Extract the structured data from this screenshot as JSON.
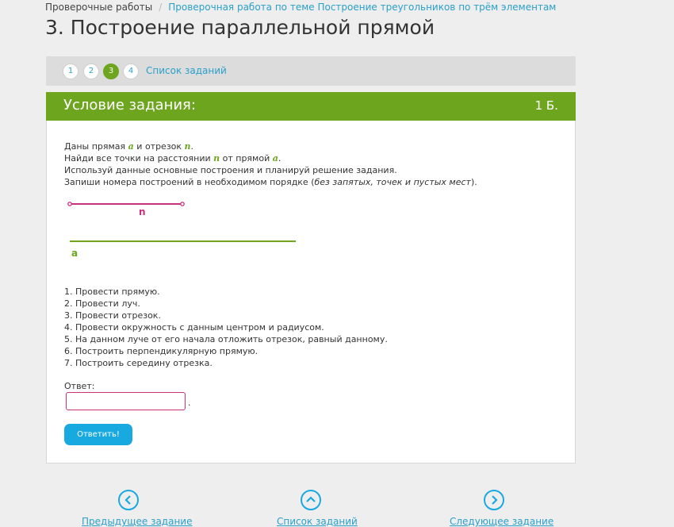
{
  "breadcrumb": {
    "root": "Проверочные работы",
    "current": "Проверочная работа по теме Построение треугольников по трём элементам"
  },
  "page_title": "3. Построение параллельной прямой",
  "steps_nav": {
    "items": [
      "1",
      "2",
      "3",
      "4"
    ],
    "active": "3",
    "task_list_link": "Список заданий"
  },
  "card": {
    "title": "Условие задания:",
    "points": "1 Б.",
    "condition": {
      "line1_pre": "Даны прямая ",
      "var_a": "a",
      "line1_mid": " и отрезок ",
      "var_n": "n",
      "line1_end": ".",
      "line2_pre": "Найди все точки на расстоянии ",
      "line2_mid": " от прямой ",
      "line2_end": ".",
      "line3": "Используй данные основные построения и планируй решение задания.",
      "line4_pre": "Запиши номера построений в необходимом порядке (",
      "line4_italic": "без запятых, точек и пустых мест",
      "line4_end": ")."
    },
    "figure": {
      "segment_label": "n",
      "line_label": "a",
      "segment_color": "#c8327d",
      "line_color": "#6ea51e"
    },
    "steps": [
      "1. Провести прямую.",
      "2. Провести луч.",
      "3. Провести отрезок.",
      "4. Провести окружность с данным центром и радиусом.",
      "5. На данном луче от его начала отложить отрезок, равный данному.",
      "6. Построить перпендикулярную прямую.",
      "7. Построить середину отрезка."
    ],
    "answer_label": "Ответ:",
    "answer_value": "",
    "answer_suffix": ".",
    "submit_label": "Ответить!"
  },
  "bottom_nav": {
    "prev_label": "Предыдущее задание",
    "list_label": "Список заданий",
    "next_label": "Следующее задание"
  },
  "colors": {
    "accent_green": "#6ea51e",
    "accent_blue": "#18a9e0",
    "link": "#2aa0c9",
    "input_border": "#c8327d"
  }
}
